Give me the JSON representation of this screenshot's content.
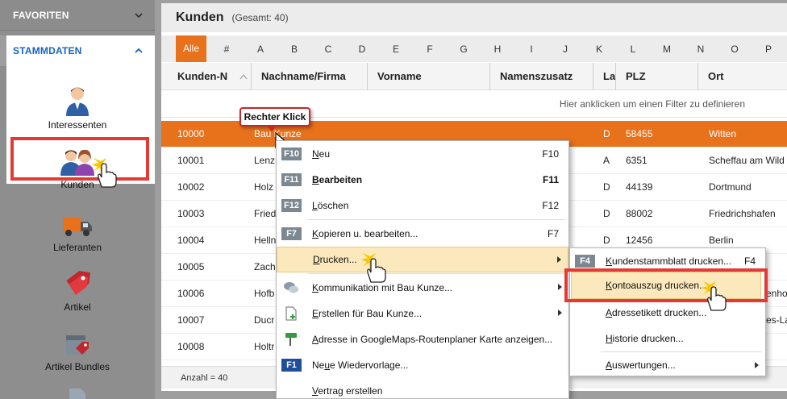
{
  "sidebar": {
    "favoriten": "FAVORITEN",
    "stammdaten": "STAMMDATEN",
    "items": [
      {
        "label": "Interessenten",
        "icon": "person-icon"
      },
      {
        "label": "Kunden",
        "icon": "customers-icon"
      },
      {
        "label": "Lieferanten",
        "icon": "truck-icon"
      },
      {
        "label": "Artikel",
        "icon": "tag-icon"
      },
      {
        "label": "Artikel Bundles",
        "icon": "box-tag-icon"
      }
    ]
  },
  "header": {
    "title": "Kunden",
    "subtitle": "(Gesamt: 40)"
  },
  "alphabet": [
    "Alle",
    "#",
    "A",
    "B",
    "C",
    "D",
    "E",
    "F",
    "G",
    "H",
    "I",
    "J",
    "K",
    "L",
    "M",
    "N",
    "O",
    "P"
  ],
  "columns": [
    "Kunden-N",
    "Nachname/Firma",
    "Vorname",
    "Namenszusatz",
    "La",
    "PLZ",
    "Ort"
  ],
  "filter_hint": "Hier anklicken um einen Filter zu definieren",
  "rows": [
    {
      "nr": "10000",
      "name": "Bau Kunze",
      "land": "D",
      "plz": "58455",
      "ort": "Witten"
    },
    {
      "nr": "10001",
      "name": "Lenz",
      "land": "A",
      "plz": "6351",
      "ort": "Scheffau am Wild"
    },
    {
      "nr": "10002",
      "name": "Holz",
      "land": "D",
      "plz": "44139",
      "ort": "Dortmund"
    },
    {
      "nr": "10003",
      "name": "Fried",
      "land": "D",
      "plz": "88002",
      "ort": "Friedrichshafen"
    },
    {
      "nr": "10004",
      "name": "Helln",
      "land": "D",
      "plz": "12456",
      "ort": "Berlin"
    },
    {
      "nr": "10005",
      "name": "Zach",
      "land": "",
      "plz": "",
      "ort": ""
    },
    {
      "nr": "10006",
      "name": "Hofb",
      "land": "",
      "plz": "",
      "ort": "enho"
    },
    {
      "nr": "10007",
      "name": "Ducr",
      "land": "",
      "plz": "",
      "ort": "es-La"
    },
    {
      "nr": "10008",
      "name": "Holtr",
      "land": "",
      "plz": "",
      "ort": ""
    }
  ],
  "footer": "Anzahl = 40",
  "callout": "Rechter Klick",
  "context_menu": [
    {
      "key": "F10",
      "pre": "",
      "u": "N",
      "post": "eu",
      "shortcut": "F10"
    },
    {
      "key": "F11",
      "pre": "",
      "u": "B",
      "post": "earbeiten",
      "shortcut": "F11",
      "bold": true
    },
    {
      "key": "F12",
      "pre": "",
      "u": "L",
      "post": "öschen",
      "shortcut": "F12"
    },
    {
      "key": "F7",
      "pre": "",
      "u": "K",
      "post": "opieren u. bearbeiten...",
      "shortcut": "F7"
    },
    {
      "pre": "",
      "u": "D",
      "post": "rucken...",
      "submenu": true
    },
    {
      "pre": "",
      "u": "K",
      "post": "ommunikation mit Bau Kunze...",
      "submenu": true
    },
    {
      "pre": "",
      "u": "E",
      "post": "rstellen für Bau Kunze...",
      "submenu": true
    },
    {
      "pre": "",
      "u": "A",
      "post": "dresse in GoogleMaps-Routenplaner Karte anzeigen..."
    },
    {
      "key": "F1",
      "pre": "Ne",
      "u": "u",
      "post": "e Wiedervorlage..."
    },
    {
      "pre": "",
      "u": "V",
      "post": "ertrag erstellen"
    }
  ],
  "submenu": [
    {
      "key": "F4",
      "pre": "",
      "u": "K",
      "post": "undenstammblatt drucken...",
      "shortcut": "F4"
    },
    {
      "pre": "",
      "u": "K",
      "post": "ontoauszug drucken..."
    },
    {
      "pre": "",
      "u": "A",
      "post": "dressetikett drucken..."
    },
    {
      "pre": "",
      "u": "H",
      "post": "istorie drucken..."
    },
    {
      "pre": "",
      "u": "A",
      "post": "uswertungen...",
      "submenu": true
    }
  ],
  "colors": {
    "accent": "#e8711b",
    "highlight": "#fbe9bd",
    "annotation": "#e53935",
    "link": "#1565c0"
  }
}
